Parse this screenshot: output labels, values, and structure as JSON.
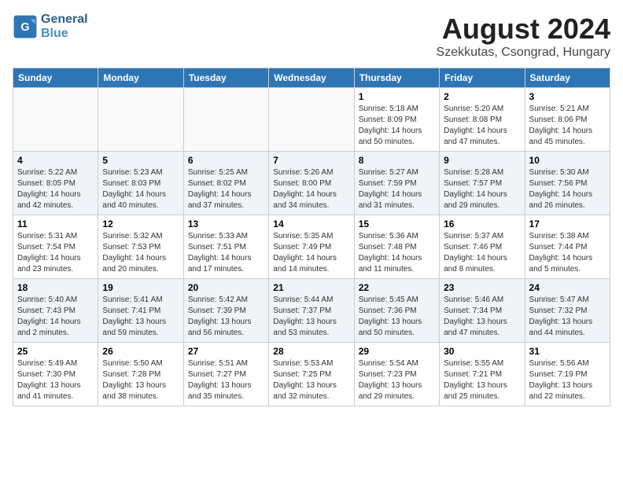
{
  "header": {
    "logo_line1": "General",
    "logo_line2": "Blue",
    "month_title": "August 2024",
    "location": "Szekkutas, Csongrad, Hungary"
  },
  "days_of_week": [
    "Sunday",
    "Monday",
    "Tuesday",
    "Wednesday",
    "Thursday",
    "Friday",
    "Saturday"
  ],
  "weeks": [
    [
      {
        "day": "",
        "info": ""
      },
      {
        "day": "",
        "info": ""
      },
      {
        "day": "",
        "info": ""
      },
      {
        "day": "",
        "info": ""
      },
      {
        "day": "1",
        "info": "Sunrise: 5:18 AM\nSunset: 8:09 PM\nDaylight: 14 hours\nand 50 minutes."
      },
      {
        "day": "2",
        "info": "Sunrise: 5:20 AM\nSunset: 8:08 PM\nDaylight: 14 hours\nand 47 minutes."
      },
      {
        "day": "3",
        "info": "Sunrise: 5:21 AM\nSunset: 8:06 PM\nDaylight: 14 hours\nand 45 minutes."
      }
    ],
    [
      {
        "day": "4",
        "info": "Sunrise: 5:22 AM\nSunset: 8:05 PM\nDaylight: 14 hours\nand 42 minutes."
      },
      {
        "day": "5",
        "info": "Sunrise: 5:23 AM\nSunset: 8:03 PM\nDaylight: 14 hours\nand 40 minutes."
      },
      {
        "day": "6",
        "info": "Sunrise: 5:25 AM\nSunset: 8:02 PM\nDaylight: 14 hours\nand 37 minutes."
      },
      {
        "day": "7",
        "info": "Sunrise: 5:26 AM\nSunset: 8:00 PM\nDaylight: 14 hours\nand 34 minutes."
      },
      {
        "day": "8",
        "info": "Sunrise: 5:27 AM\nSunset: 7:59 PM\nDaylight: 14 hours\nand 31 minutes."
      },
      {
        "day": "9",
        "info": "Sunrise: 5:28 AM\nSunset: 7:57 PM\nDaylight: 14 hours\nand 29 minutes."
      },
      {
        "day": "10",
        "info": "Sunrise: 5:30 AM\nSunset: 7:56 PM\nDaylight: 14 hours\nand 26 minutes."
      }
    ],
    [
      {
        "day": "11",
        "info": "Sunrise: 5:31 AM\nSunset: 7:54 PM\nDaylight: 14 hours\nand 23 minutes."
      },
      {
        "day": "12",
        "info": "Sunrise: 5:32 AM\nSunset: 7:53 PM\nDaylight: 14 hours\nand 20 minutes."
      },
      {
        "day": "13",
        "info": "Sunrise: 5:33 AM\nSunset: 7:51 PM\nDaylight: 14 hours\nand 17 minutes."
      },
      {
        "day": "14",
        "info": "Sunrise: 5:35 AM\nSunset: 7:49 PM\nDaylight: 14 hours\nand 14 minutes."
      },
      {
        "day": "15",
        "info": "Sunrise: 5:36 AM\nSunset: 7:48 PM\nDaylight: 14 hours\nand 11 minutes."
      },
      {
        "day": "16",
        "info": "Sunrise: 5:37 AM\nSunset: 7:46 PM\nDaylight: 14 hours\nand 8 minutes."
      },
      {
        "day": "17",
        "info": "Sunrise: 5:38 AM\nSunset: 7:44 PM\nDaylight: 14 hours\nand 5 minutes."
      }
    ],
    [
      {
        "day": "18",
        "info": "Sunrise: 5:40 AM\nSunset: 7:43 PM\nDaylight: 14 hours\nand 2 minutes."
      },
      {
        "day": "19",
        "info": "Sunrise: 5:41 AM\nSunset: 7:41 PM\nDaylight: 13 hours\nand 59 minutes."
      },
      {
        "day": "20",
        "info": "Sunrise: 5:42 AM\nSunset: 7:39 PM\nDaylight: 13 hours\nand 56 minutes."
      },
      {
        "day": "21",
        "info": "Sunrise: 5:44 AM\nSunset: 7:37 PM\nDaylight: 13 hours\nand 53 minutes."
      },
      {
        "day": "22",
        "info": "Sunrise: 5:45 AM\nSunset: 7:36 PM\nDaylight: 13 hours\nand 50 minutes."
      },
      {
        "day": "23",
        "info": "Sunrise: 5:46 AM\nSunset: 7:34 PM\nDaylight: 13 hours\nand 47 minutes."
      },
      {
        "day": "24",
        "info": "Sunrise: 5:47 AM\nSunset: 7:32 PM\nDaylight: 13 hours\nand 44 minutes."
      }
    ],
    [
      {
        "day": "25",
        "info": "Sunrise: 5:49 AM\nSunset: 7:30 PM\nDaylight: 13 hours\nand 41 minutes."
      },
      {
        "day": "26",
        "info": "Sunrise: 5:50 AM\nSunset: 7:28 PM\nDaylight: 13 hours\nand 38 minutes."
      },
      {
        "day": "27",
        "info": "Sunrise: 5:51 AM\nSunset: 7:27 PM\nDaylight: 13 hours\nand 35 minutes."
      },
      {
        "day": "28",
        "info": "Sunrise: 5:53 AM\nSunset: 7:25 PM\nDaylight: 13 hours\nand 32 minutes."
      },
      {
        "day": "29",
        "info": "Sunrise: 5:54 AM\nSunset: 7:23 PM\nDaylight: 13 hours\nand 29 minutes."
      },
      {
        "day": "30",
        "info": "Sunrise: 5:55 AM\nSunset: 7:21 PM\nDaylight: 13 hours\nand 25 minutes."
      },
      {
        "day": "31",
        "info": "Sunrise: 5:56 AM\nSunset: 7:19 PM\nDaylight: 13 hours\nand 22 minutes."
      }
    ]
  ]
}
